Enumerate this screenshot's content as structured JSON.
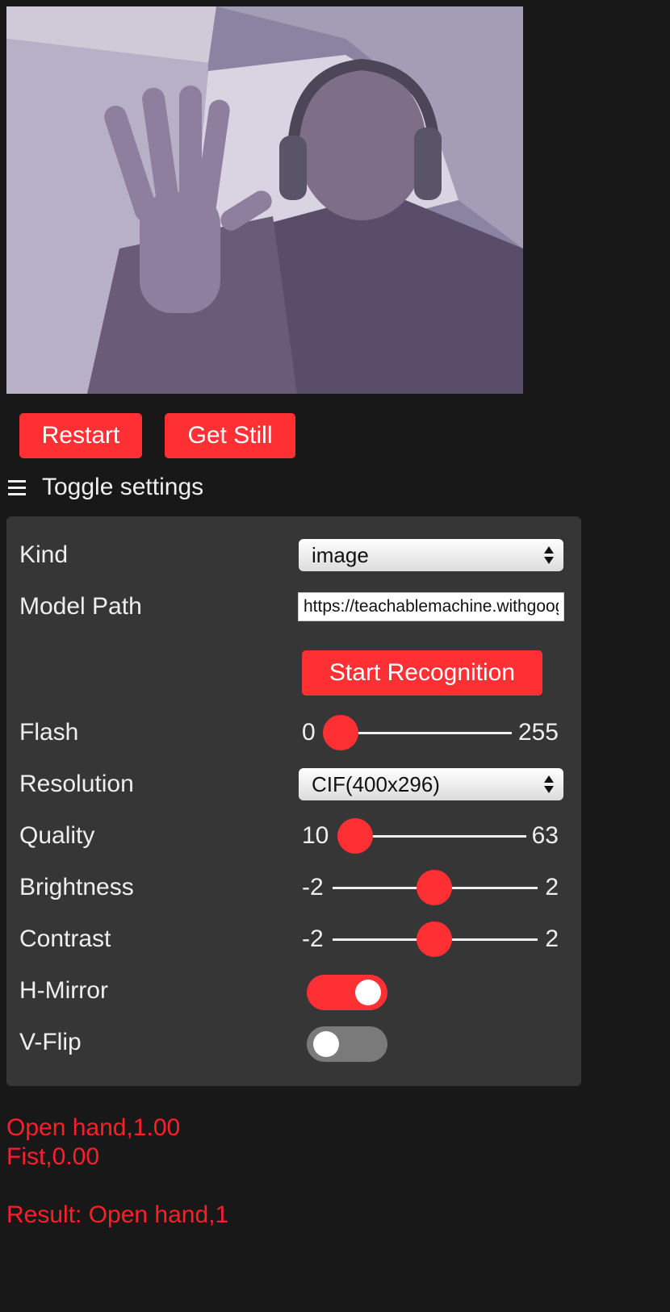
{
  "stream": {
    "description_label": ""
  },
  "buttons": {
    "restart": "Restart",
    "get_still": "Get Still",
    "start_recognition": "Start Recognition"
  },
  "settings": {
    "toggle_label": "Toggle settings",
    "kind": {
      "label": "Kind",
      "value": "image"
    },
    "model_path": {
      "label": "Model Path",
      "value": "https://teachablemachine.withgoogle.com/models/"
    },
    "flash": {
      "label": "Flash",
      "min": "0",
      "max": "255",
      "value": 0
    },
    "resolution": {
      "label": "Resolution",
      "value": "CIF(400x296)"
    },
    "quality": {
      "label": "Quality",
      "min": "10",
      "max": "63",
      "value": 10
    },
    "brightness": {
      "label": "Brightness",
      "min": "-2",
      "max": "2",
      "value": 0
    },
    "contrast": {
      "label": "Contrast",
      "min": "-2",
      "max": "2",
      "value": 0
    },
    "hmirror": {
      "label": "H-Mirror",
      "on": true
    },
    "vflip": {
      "label": "V-Flip",
      "on": false
    }
  },
  "results": {
    "line1": "Open hand,1.00",
    "line2": "Fist,0.00",
    "result": "Result: Open hand,1"
  },
  "colors": {
    "accent": "#ff3034",
    "background": "#181818",
    "panel": "#363636",
    "result_text": "#ff1f2b"
  }
}
